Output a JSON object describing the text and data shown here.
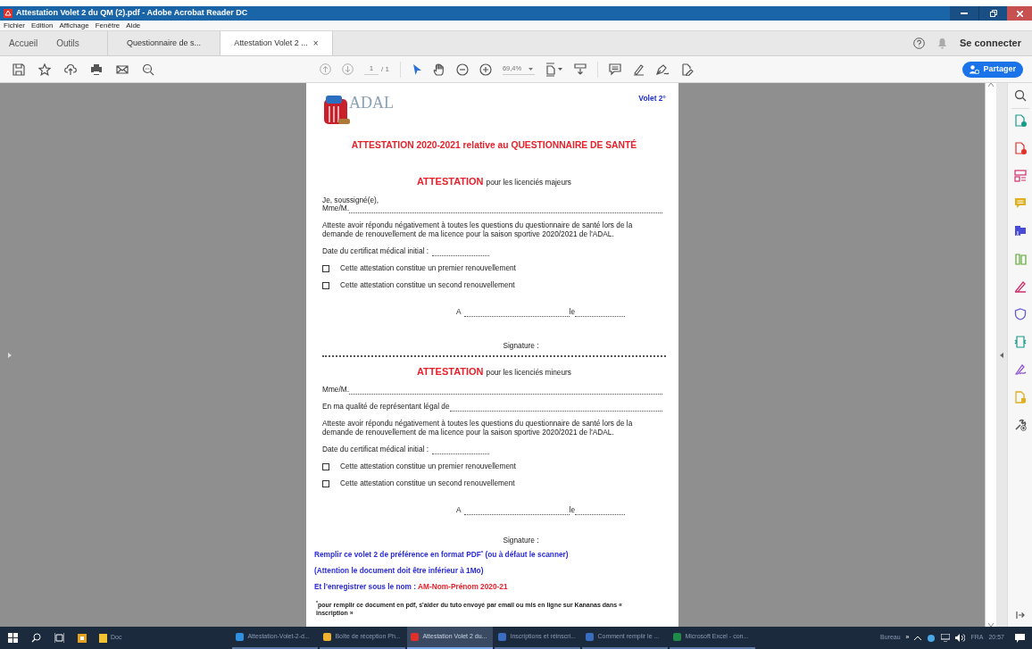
{
  "window": {
    "title": "Attestation Volet 2 du QM (2).pdf - Adobe Acrobat Reader DC"
  },
  "menu": [
    "Fichier",
    "Edition",
    "Affichage",
    "Fenêtre",
    "Aide"
  ],
  "tabs": [
    {
      "label": "Accueil",
      "kind": "nav",
      "selected": false
    },
    {
      "label": "Outils",
      "kind": "nav",
      "selected": false
    },
    {
      "label": "Questionnaire de s...",
      "kind": "doc",
      "selected": false
    },
    {
      "label": "Attestation Volet 2 ...",
      "kind": "doc",
      "selected": true,
      "close": "×"
    }
  ],
  "account": {
    "sign_in": "Se connecter"
  },
  "toolbar": {
    "page_current": "1",
    "page_total": "/ 1",
    "zoom": "69,4%",
    "share": "Partager"
  },
  "document": {
    "logo_text": "ADAL",
    "volet": "Volet 2°",
    "title": "ATTESTATION 2020-2021 relative au QUESTIONNAIRE DE SANTÉ",
    "sections": [
      {
        "heading": "ATTESTATION",
        "subheading": "pour les licenciés majeurs",
        "lines": [
          {
            "kind": "text",
            "text": "Je, soussigné(e),"
          },
          {
            "kind": "blank",
            "text": "Mme/M."
          },
          {
            "kind": "paragraph",
            "text": "Atteste avoir répondu négativement à toutes les questions du questionnaire de santé lors de la demande de renouvellement de ma licence pour la saison sportive 2020/2021 de l'ADAL."
          },
          {
            "kind": "short",
            "text": "Date du certificat médical initial :"
          },
          {
            "kind": "checkbox",
            "text": "Cette attestation constitue un premier renouvellement",
            "checked": false
          },
          {
            "kind": "checkbox",
            "text": "Cette attestation constitue un second renouvellement",
            "checked": false
          },
          {
            "kind": "place",
            "text": "A",
            "text2": "le"
          },
          {
            "kind": "signature",
            "text": "Signature :"
          }
        ]
      },
      {
        "heading": "ATTESTATION",
        "subheading": "pour les licenciés mineurs",
        "lines": [
          {
            "kind": "blank",
            "text": "Mme/M."
          },
          {
            "kind": "blank",
            "text": "En ma qualité de représentant légal de"
          },
          {
            "kind": "paragraph",
            "text": "Atteste avoir répondu négativement à toutes les questions du questionnaire de santé lors de la demande de renouvellement de ma licence pour la saison sportive 2020/2021 de l'ADAL."
          },
          {
            "kind": "short",
            "text": "Date du certificat médical initial :"
          },
          {
            "kind": "checkbox",
            "text": "Cette attestation constitue un premier renouvellement",
            "checked": false
          },
          {
            "kind": "checkbox",
            "text": "Cette attestation constitue un second renouvellement",
            "checked": false
          },
          {
            "kind": "place",
            "text": "A",
            "text2": "le"
          },
          {
            "kind": "signature",
            "text": "Signature :"
          }
        ]
      }
    ],
    "notes": [
      {
        "text": "Remplir ce volet 2 de préférence en format PDF$^{*}$ (ou à défaut le scanner)"
      },
      {
        "text": "(Attention le document doit être inférieur à 1Mo)"
      },
      {
        "text": "Et l'enregistrer sous le nom :",
        "value": "AM-Nom-Prénom 2020-21"
      }
    ],
    "footnote": "$^{*}$pour remplir ce document en pdf, s'aider du tuto envoyé par email ou mis en ligne sur Kananas dans « inscription »"
  },
  "taskbar": {
    "pinned": [
      {
        "label": "Doc",
        "color": "#f2c230"
      }
    ],
    "items": [
      {
        "label": "Attestation-Volet-2-d...",
        "color": "#2f8fe0",
        "selected": false
      },
      {
        "label": "Boîte de réception Ph...",
        "color": "#f0b030",
        "selected": false
      },
      {
        "label": "Attestation Volet 2 du...",
        "color": "#e0302a",
        "selected": true
      },
      {
        "label": "Inscriptions et réinscri...",
        "color": "#3a6cc0",
        "selected": false
      },
      {
        "label": "Comment remplir le ...",
        "color": "#3a6cc0",
        "selected": false
      },
      {
        "label": "Microsoft Excel - con...",
        "color": "#1f8a4a",
        "selected": false
      }
    ],
    "tray": {
      "desktop": "Bureau",
      "more": "»",
      "language": "FRA",
      "time": "20:57"
    }
  }
}
